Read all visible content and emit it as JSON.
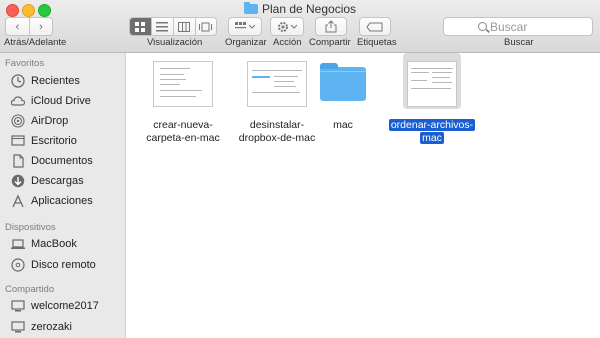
{
  "window": {
    "title": "Plan de Negocios"
  },
  "toolbar": {
    "nav_label": "Atrás/Adelante",
    "view_label": "Visualización",
    "arrange_label": "Organizar",
    "action_label": "Acción",
    "share_label": "Compartir",
    "tags_label": "Etiquetas",
    "search_label": "Buscar",
    "search_placeholder": "Buscar"
  },
  "sidebar": {
    "sections": [
      {
        "header": "Favoritos",
        "items": [
          {
            "label": "Recientes",
            "icon": "clock-icon"
          },
          {
            "label": "iCloud Drive",
            "icon": "cloud-icon"
          },
          {
            "label": "AirDrop",
            "icon": "airdrop-icon"
          },
          {
            "label": "Escritorio",
            "icon": "desktop-icon"
          },
          {
            "label": "Documentos",
            "icon": "document-icon"
          },
          {
            "label": "Descargas",
            "icon": "download-icon"
          },
          {
            "label": "Aplicaciones",
            "icon": "applications-icon"
          }
        ]
      },
      {
        "header": "Dispositivos",
        "items": [
          {
            "label": "MacBook",
            "icon": "laptop-icon"
          },
          {
            "label": "Disco remoto",
            "icon": "disc-icon"
          }
        ]
      },
      {
        "header": "Compartido",
        "items": [
          {
            "label": "welcome2017",
            "icon": "computer-icon"
          },
          {
            "label": "zerozaki",
            "icon": "computer-icon"
          }
        ]
      }
    ]
  },
  "files": [
    {
      "name_line1": "crear-nueva-",
      "name_line2": "carpeta-en-mac",
      "kind": "image"
    },
    {
      "name_line1": "desinstalar-",
      "name_line2": "dropbox-de-mac",
      "kind": "image"
    },
    {
      "name_line1": "mac",
      "name_line2": "",
      "kind": "folder"
    },
    {
      "name_line1": "ordenar-archivos-",
      "name_line2": "mac",
      "kind": "image",
      "selected": true
    }
  ],
  "colors": {
    "selection": "#1a5fd1",
    "folder": "#5db4f0"
  }
}
